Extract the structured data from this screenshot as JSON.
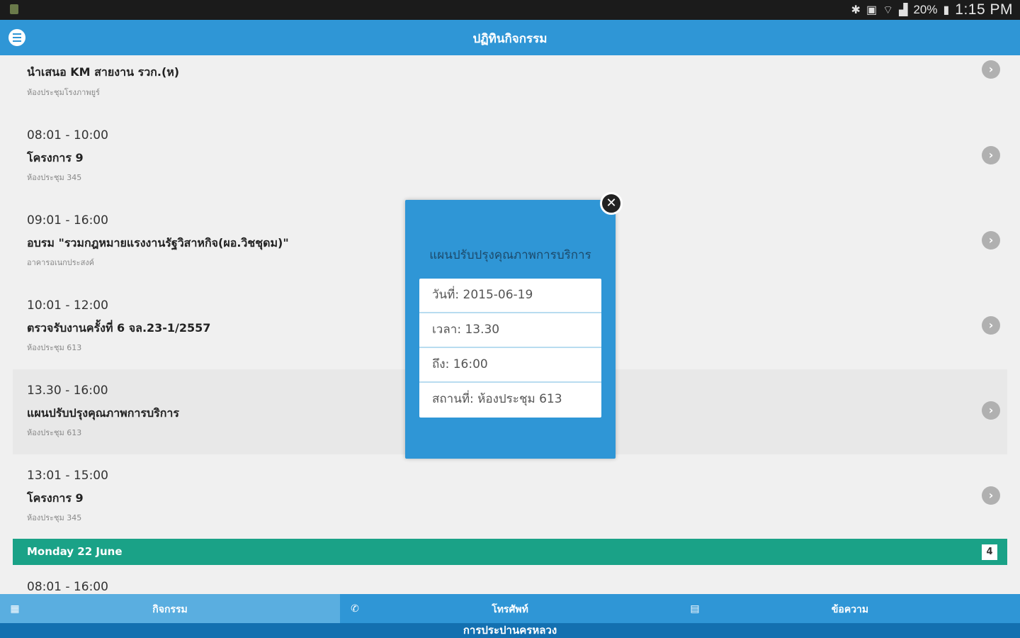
{
  "status_bar": {
    "battery": "20%",
    "time": "1:15 PM"
  },
  "app_bar": {
    "title": "ปฏิทินกิจกรรม"
  },
  "list": {
    "items": [
      {
        "time": "",
        "name": "นำเสนอ KM สายงาน รวก.(ห)",
        "place": "ห้องประชุมโรงภาพยูร์"
      },
      {
        "time": "08:01 - 10:00",
        "name": "โครงการ 9",
        "place": "ห้องประชุม 345"
      },
      {
        "time": "09:01 - 16:00",
        "name": "อบรม \"รวมกฎหมายแรงงานรัฐวิสาหกิจ(ผอ.วิชชุดม)\"",
        "place": "อาคารอเนกประสงค์"
      },
      {
        "time": "10:01 - 12:00",
        "name": "ตรวจรับงานครั้งที่ 6 จล.23-1/2557",
        "place": "ห้องประชุม 613"
      },
      {
        "time": "13.30 - 16:00",
        "name": "แผนปรับปรุงคุณภาพการบริการ",
        "place": "ห้องประชุม 613"
      },
      {
        "time": "13:01 - 15:00",
        "name": "โครงการ 9",
        "place": "ห้องประชุม 345"
      }
    ],
    "day_header": {
      "label": "Monday 22 June",
      "count": "4"
    },
    "next_item_time": "08:01 - 16:00"
  },
  "bottom_nav": {
    "tabs": [
      {
        "label": "กิจกรรม",
        "icon": "grid-icon"
      },
      {
        "label": "โทรศัพท์",
        "icon": "phone-icon"
      },
      {
        "label": "ข้อความ",
        "icon": "message-icon"
      }
    ],
    "footer": "การประปานครหลวง"
  },
  "modal": {
    "title": "แผนปรับปรุงคุณภาพการบริการ",
    "rows": [
      "วันที่: 2015-06-19",
      "เวลา: 13.30",
      "ถึง: 16:00",
      "สถานที่: ห้องประชุม 613"
    ]
  },
  "colors": {
    "primary": "#2f96d6",
    "day_header": "#1aa287",
    "footer": "#1370b0"
  }
}
